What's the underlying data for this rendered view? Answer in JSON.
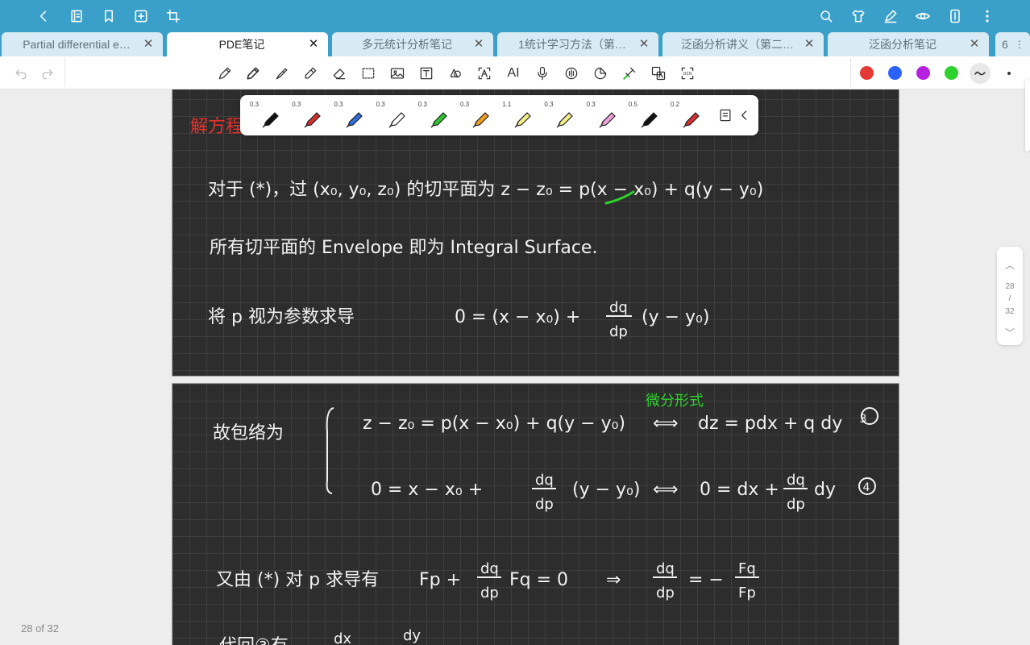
{
  "tabs": [
    {
      "label": "Partial differential e…",
      "active": false
    },
    {
      "label": "PDE笔记",
      "active": true
    },
    {
      "label": "多元统计分析笔记",
      "active": false
    },
    {
      "label": "1统计学习方法（第…",
      "active": false
    },
    {
      "label": "泛函分析讲义（第二…",
      "active": false
    },
    {
      "label": "泛函分析笔记",
      "active": false
    }
  ],
  "tab_overflow": "6",
  "pen_widths": [
    "0.3",
    "0.3",
    "0.3",
    "0.3",
    "0.3",
    "0.3",
    "1.1",
    "0.3",
    "0.3",
    "0.5",
    "0.2"
  ],
  "pen_colors": [
    "#111111",
    "#d33030",
    "#2f6fd8",
    "#ffffff",
    "#2ec62e",
    "#f0a020",
    "#f3f08a",
    "#f3f08a",
    "#f0a0d8",
    "#111111",
    "#d33030"
  ],
  "palette": [
    "#e53935",
    "#2962ff",
    "#b620e0",
    "#2ed12e"
  ],
  "scroller": {
    "current": "28",
    "sep": "/",
    "total": "32"
  },
  "page_counter": "28 of 32",
  "notes": {
    "heading": "解方程:",
    "line1": "对于 (*)，过 (x₀, y₀, z₀) 的切平面为  z − z₀ = p(x − x₀) + q(y − y₀)",
    "line2": "所有切平面的 Envelope 即为 Integral Surface.",
    "line3_left": "将 p 视为参数求导",
    "line3_eq": "0 = (x − x₀) +",
    "frac_num": "dq",
    "frac_den": "dp",
    "line3_tail": "(y − y₀)",
    "note_green": "微分形式",
    "env_label": "故包络为",
    "eq3_left": "z − z₀ = p(x − x₀) + q(y − y₀)",
    "eq3_right": "dz = pdx + q dy",
    "num3": "3",
    "eq4_left": "0 = x − x₀ +",
    "eq4_tail": "(y − y₀)",
    "eq4_right": "0 = dx +",
    "eq4_right_tail": "dy",
    "num4": "4",
    "iff": "⟺",
    "line5_left": "又由 (*) 对 p 求导有",
    "line5_eq": "Fp +",
    "line5_tail": "Fq = 0",
    "implies": "⇒",
    "line5_res_tail": "= −",
    "fq": "Fq",
    "fp": "Fp",
    "cut_left": "代回③有",
    "cut_dx": "dx",
    "cut_dy": "dy"
  }
}
